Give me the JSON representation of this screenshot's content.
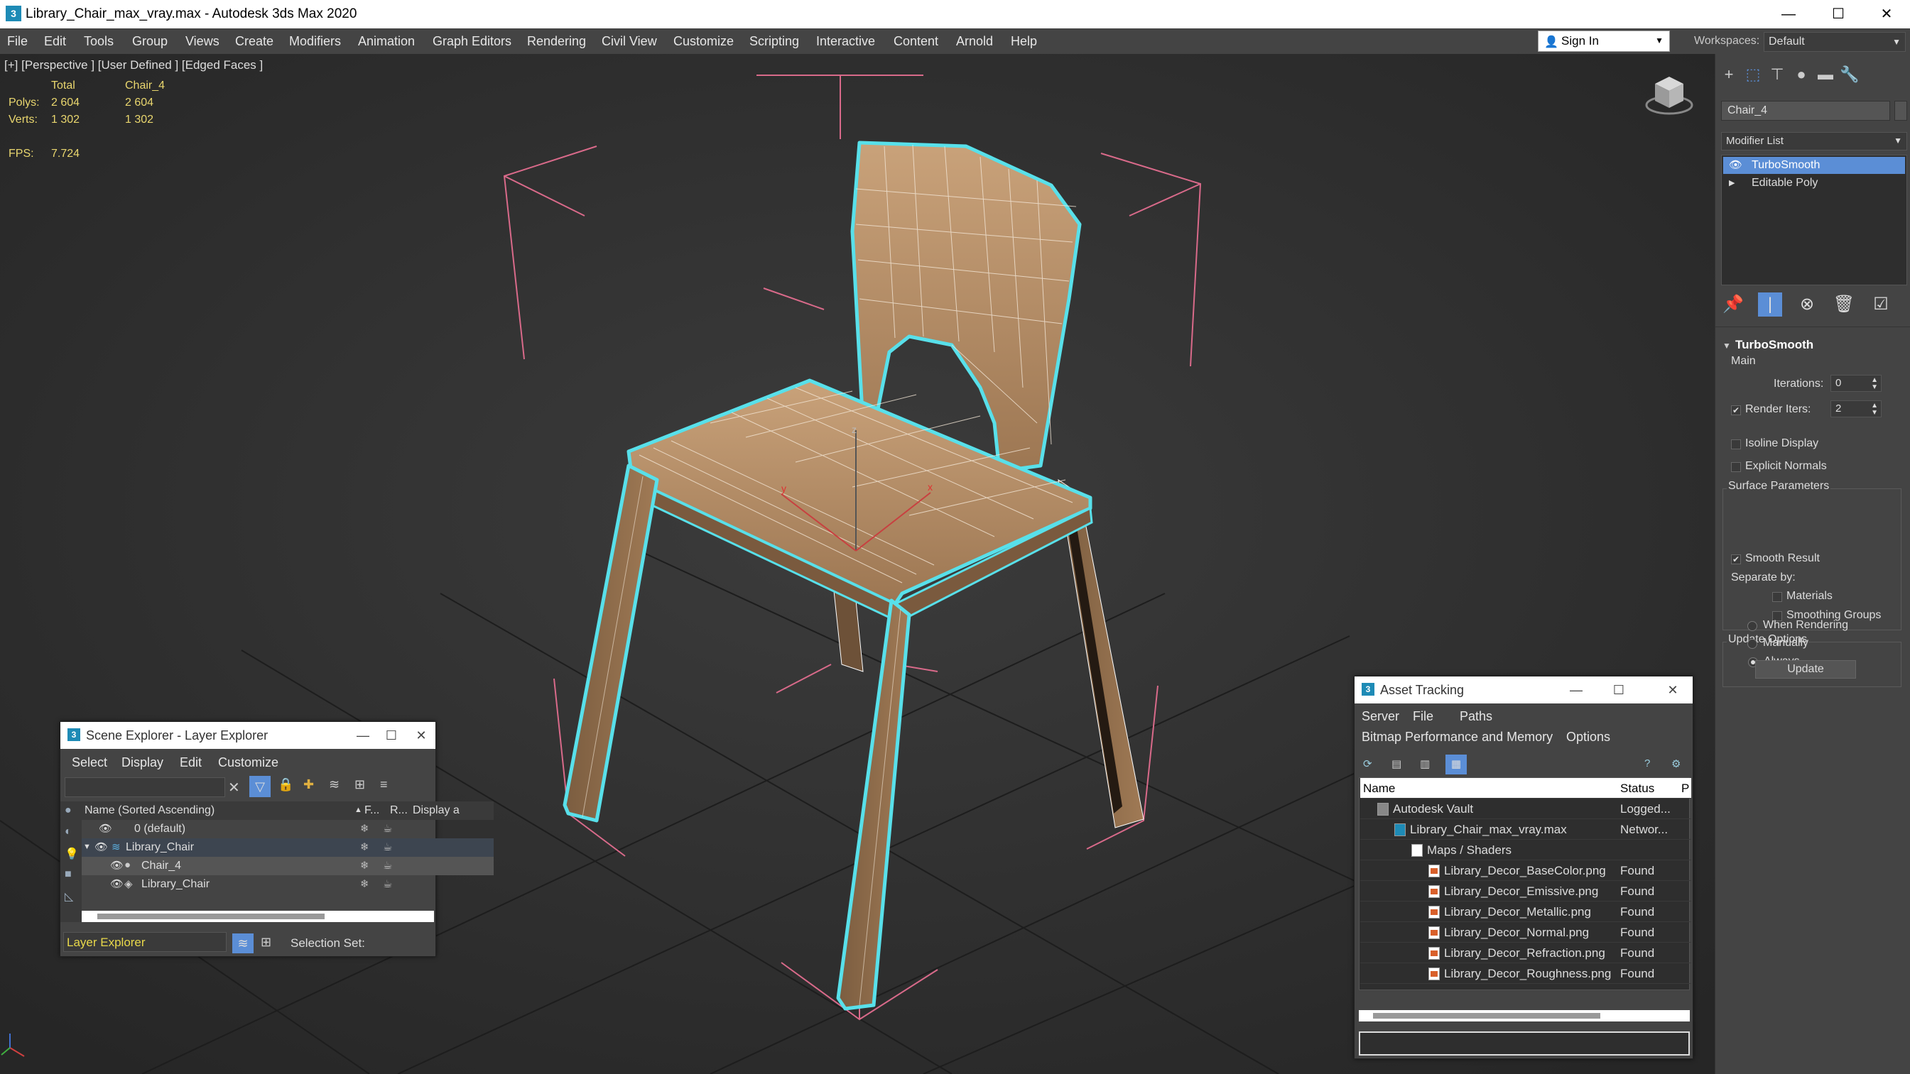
{
  "window": {
    "title": "Library_Chair_max_vray.max - Autodesk 3ds Max 2020",
    "minimize": "—",
    "maximize": "☐",
    "close": "✕"
  },
  "menu": [
    "File",
    "Edit",
    "Tools",
    "Group",
    "Views",
    "Create",
    "Modifiers",
    "Animation",
    "Graph Editors",
    "Rendering",
    "Civil View",
    "Customize",
    "Scripting",
    "Interactive",
    "Content",
    "Arnold",
    "Help"
  ],
  "signin": {
    "label": "Sign In"
  },
  "workspace": {
    "label": "Workspaces:",
    "value": "Default"
  },
  "viewport": {
    "label": "[+] [Perspective ] [User Defined ] [Edged Faces ]",
    "stats": {
      "col_total": "Total",
      "col_object": "Chair_4",
      "polys_label": "Polys:",
      "polys_total": "2 604",
      "polys_object": "2 604",
      "verts_label": "Verts:",
      "verts_total": "1 302",
      "verts_object": "1 302",
      "fps_label": "FPS:",
      "fps_value": "7.724"
    },
    "gizmo_x": "x",
    "gizmo_y": "y",
    "gizmo_z": "z"
  },
  "command_panel": {
    "object_name": "Chair_4",
    "modifier_list": "Modifier List",
    "stack": [
      {
        "label": "TurboSmooth",
        "selected": true
      },
      {
        "label": "Editable Poly",
        "selected": false
      }
    ],
    "rollout": {
      "title": "TurboSmooth",
      "main": "Main",
      "iterations_label": "Iterations:",
      "iterations_value": "0",
      "render_iters_label": "Render Iters:",
      "render_iters_value": "2",
      "render_iters_checked": true,
      "isoline": "Isoline Display",
      "explicit_normals": "Explicit Normals",
      "surface_params": "Surface Parameters",
      "smooth_result": "Smooth Result",
      "separate_by": "Separate by:",
      "materials": "Materials",
      "smoothing_groups": "Smoothing Groups",
      "update_options": "Update Options",
      "always": "Always",
      "when_rendering": "When Rendering",
      "manually": "Manually",
      "update_button": "Update"
    }
  },
  "scene_explorer": {
    "title": "Scene Explorer - Layer Explorer",
    "menu": [
      "Select",
      "Display",
      "Edit",
      "Customize"
    ],
    "columns": {
      "name": "Name (Sorted Ascending)",
      "frozen": "F...",
      "render": "R...",
      "display": "Display a"
    },
    "rows": [
      {
        "name": "0 (default)",
        "indent": 0
      },
      {
        "name": "Library_Chair",
        "indent": 0
      },
      {
        "name": "Chair_4",
        "indent": 1
      },
      {
        "name": "Library_Chair",
        "indent": 1
      }
    ],
    "footer_explorer": "Layer Explorer",
    "footer_selection": "Selection Set:"
  },
  "asset_tracking": {
    "title": "Asset Tracking",
    "menu": [
      "Server",
      "File",
      "Paths"
    ],
    "menu2": [
      "Bitmap Performance and Memory",
      "Options"
    ],
    "columns": {
      "name": "Name",
      "status": "Status",
      "p": "P"
    },
    "rows": [
      {
        "name": "Autodesk Vault",
        "status": "Logged...",
        "indent": 0
      },
      {
        "name": "Library_Chair_max_vray.max",
        "status": "Networ...",
        "indent": 1
      },
      {
        "name": "Maps / Shaders",
        "status": "",
        "indent": 2
      },
      {
        "name": "Library_Decor_BaseColor.png",
        "status": "Found",
        "indent": 3
      },
      {
        "name": "Library_Decor_Emissive.png",
        "status": "Found",
        "indent": 3
      },
      {
        "name": "Library_Decor_Metallic.png",
        "status": "Found",
        "indent": 3
      },
      {
        "name": "Library_Decor_Normal.png",
        "status": "Found",
        "indent": 3
      },
      {
        "name": "Library_Decor_Refraction.png",
        "status": "Found",
        "indent": 3
      },
      {
        "name": "Library_Decor_Roughness.png",
        "status": "Found",
        "indent": 3
      }
    ]
  }
}
